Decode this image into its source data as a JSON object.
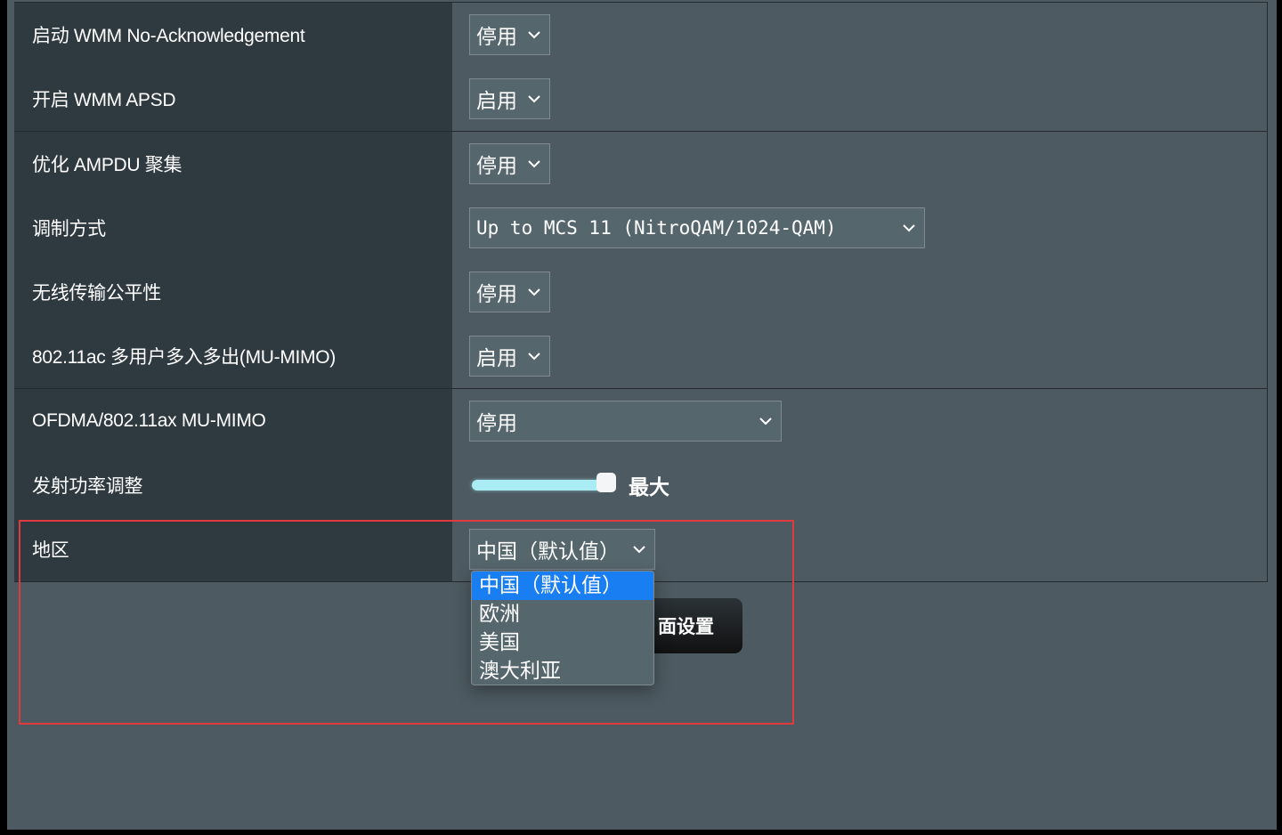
{
  "rows": [
    {
      "label": "启动 WMM No-Acknowledgement",
      "value": "停用"
    },
    {
      "label": "开启 WMM APSD",
      "value": "启用"
    },
    {
      "label": "优化 AMPDU 聚集",
      "value": "停用"
    },
    {
      "label": "调制方式",
      "value": "Up to MCS 11 (NitroQAM/1024-QAM)"
    },
    {
      "label": "无线传输公平性",
      "value": "停用"
    },
    {
      "label": "802.11ac 多用户多入多出(MU-MIMO)",
      "value": "启用"
    },
    {
      "label": "OFDMA/802.11ax MU-MIMO",
      "value": "停用"
    },
    {
      "label": "发射功率调整",
      "value": "最大",
      "level": 1.0
    },
    {
      "label": "地区",
      "value": "中国（默认值）"
    }
  ],
  "region_dropdown": {
    "options": [
      "中国（默认值）",
      "欧洲",
      "美国",
      "澳大利亚"
    ],
    "selected_index": 0
  },
  "apply_button": {
    "label": "面设置"
  },
  "icons": {
    "chevron": "chevron-down-icon"
  },
  "colors": {
    "highlight": "#e0393e",
    "selected_option": "#1a7ef3",
    "slider": "#a9ecf4"
  }
}
